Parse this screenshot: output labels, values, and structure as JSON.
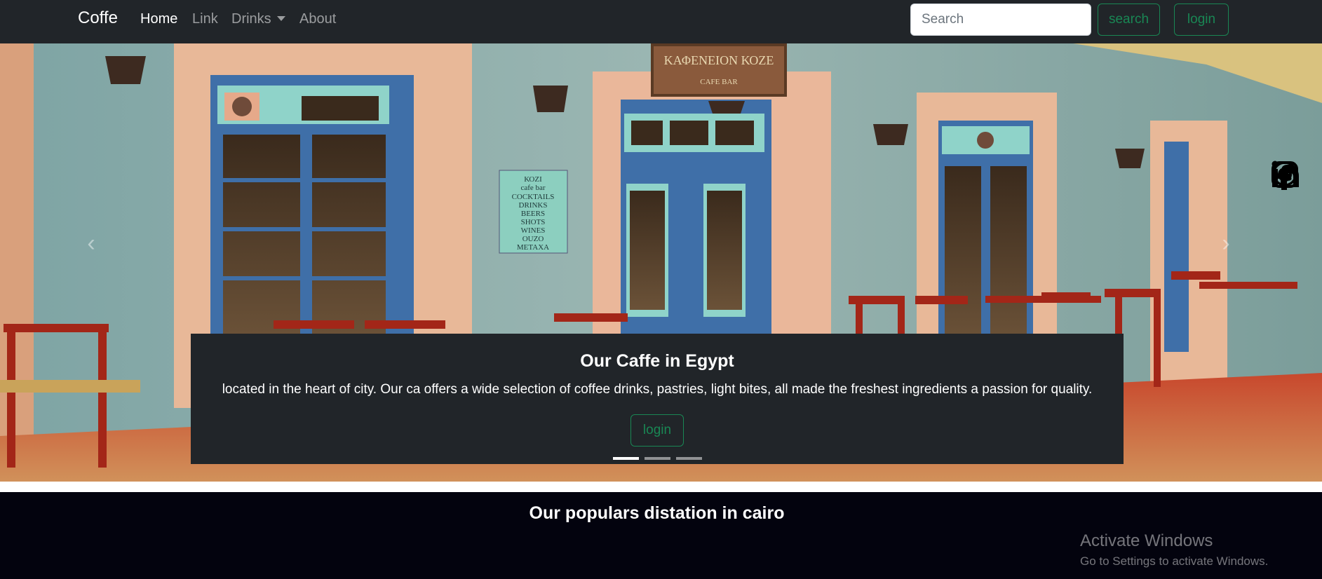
{
  "navbar": {
    "brand": "Coffe",
    "links": [
      {
        "label": "Home"
      },
      {
        "label": "Link"
      },
      {
        "label": "Drinks"
      },
      {
        "label": "About"
      }
    ],
    "search": {
      "placeholder": "Search",
      "value": ""
    },
    "search_button": "search",
    "login_button": "login"
  },
  "hero": {
    "sign_top": "ΚΑΦΕΝΕΙΟΝ ΚΟΖΕ",
    "sign_top_sub": "CAFE BAR",
    "wall_sign": [
      "ΚΟΖΙ",
      "cafe bar",
      "COCKTAILS",
      "DRINKS",
      "BEERS",
      "SHOTS",
      "WINES",
      "OUZO",
      "ΜΕΤΑΧΑ"
    ],
    "social_icons": [
      "facebook-icon",
      "whatsapp-icon",
      "instagram-icon",
      "linkedin-icon"
    ],
    "carousel_indicators": [
      true,
      false,
      false
    ]
  },
  "caption": {
    "title": "Our Caffe in Egypt",
    "text": "located in the heart of city. Our ca offers a wide selection of coffee drinks, pastries, light bites, all made the freshest ingredients a passion for quality.",
    "button": "login"
  },
  "section": {
    "title": "Our populars distation in cairo"
  },
  "os_overlay": {
    "title": "Activate Windows",
    "subtitle": "Go to Settings to activate Windows."
  },
  "colors": {
    "navbar_bg": "#212529",
    "accent_green": "#198754",
    "caption_bg": "#212529",
    "section_bg": "#03030e"
  }
}
